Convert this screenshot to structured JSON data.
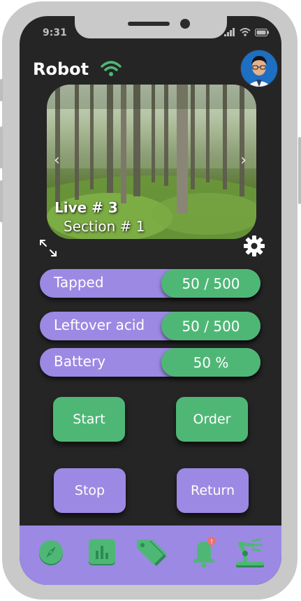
{
  "status_bar": {
    "time": "9:31"
  },
  "header": {
    "title": "Robot"
  },
  "camera": {
    "live_label": "Live # 3",
    "section_label": "Section # 1"
  },
  "stats": [
    {
      "label": "Tapped",
      "value": "50 / 500"
    },
    {
      "label": "Leftover acid",
      "value": "50 / 500"
    },
    {
      "label": "Battery",
      "value": "50 %"
    }
  ],
  "actions": {
    "start": "Start",
    "order": "Order",
    "stop": "Stop",
    "return": "Return"
  },
  "icons": {
    "wifi": "wifi-icon",
    "avatar": "avatar",
    "expand": "expand-icon",
    "settings": "gear-icon",
    "nav": [
      "compass-icon",
      "chart-icon",
      "tags-icon",
      "bell-icon",
      "robot-arm-icon"
    ]
  },
  "colors": {
    "background": "#252525",
    "primary": "#9c89e3",
    "accent": "#4fb776",
    "notification": "#e57373"
  }
}
